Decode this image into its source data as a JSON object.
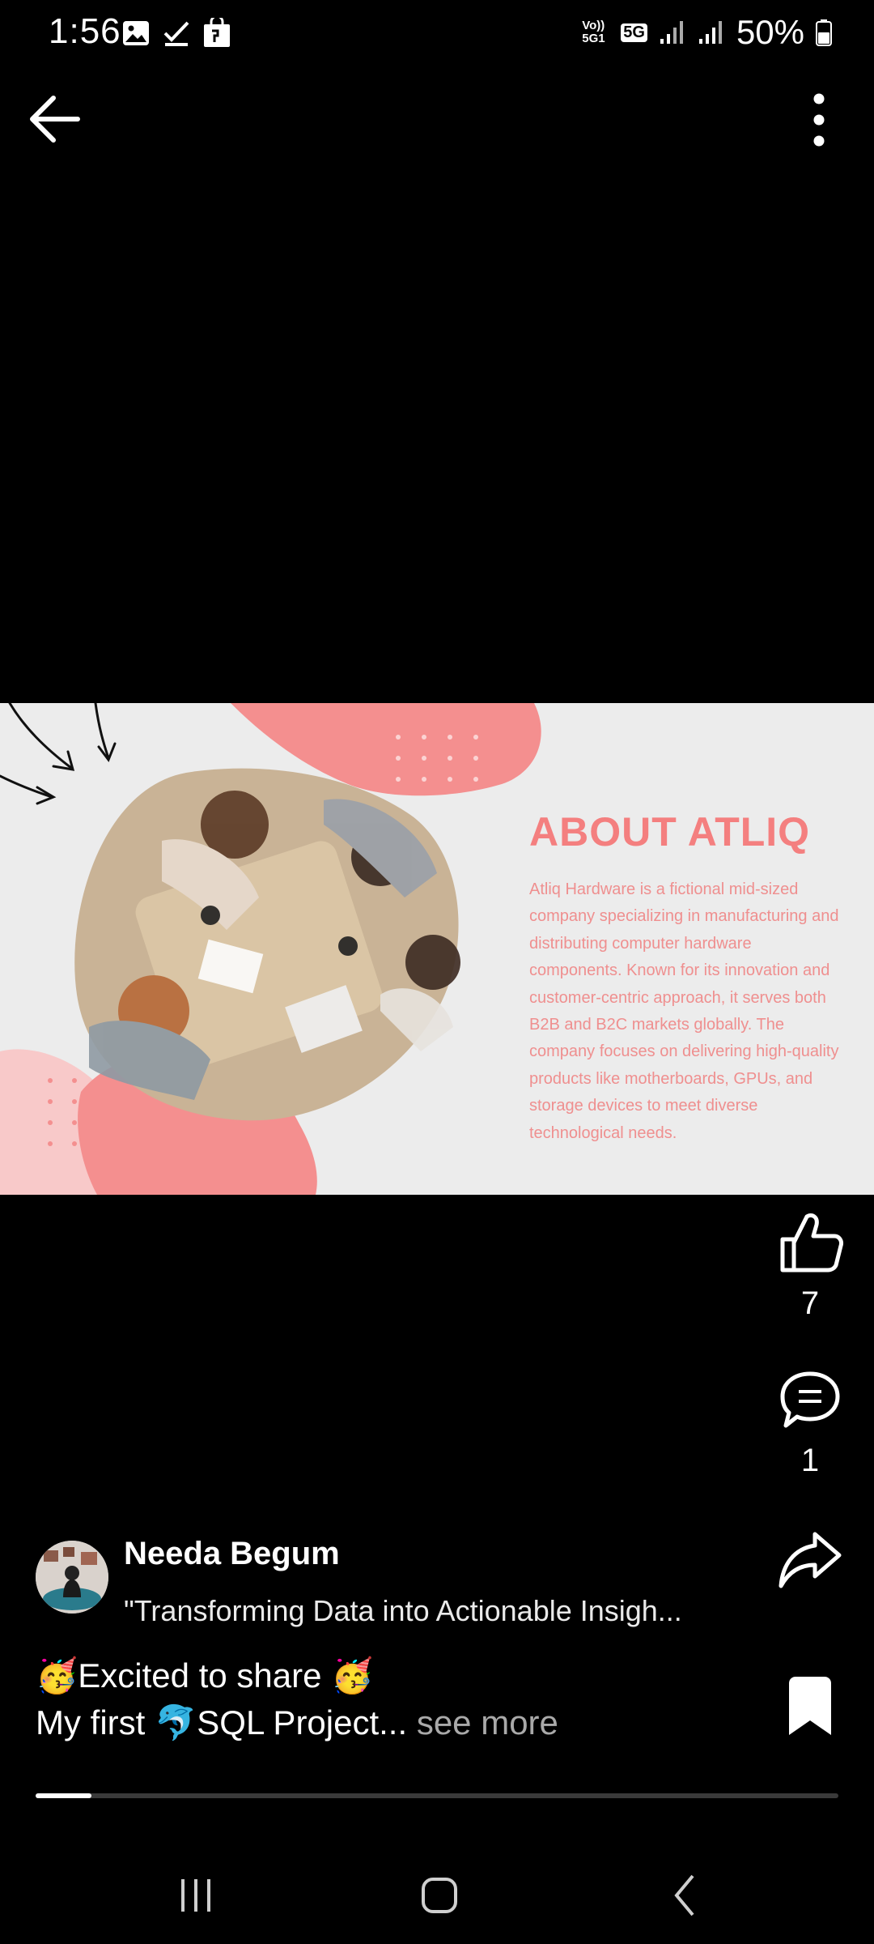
{
  "status_bar": {
    "time": "1:56",
    "network": "5G",
    "volte": "Vo)) 5G1",
    "battery_percent": "50%",
    "left_icons": [
      "image-icon",
      "checkmark-icon",
      "shopping-bag-icon"
    ]
  },
  "top_bar": {
    "back_icon": "arrow-left-icon",
    "more_icon": "more-vertical-icon"
  },
  "slide": {
    "title": "ABOUT ATLIQ",
    "body": "Atliq Hardware is a fictional mid-sized company specializing in manufacturing and distributing computer hardware components. Known for its innovation and customer-centric approach, it serves both B2B and B2C markets globally. The company focuses on delivering high-quality products like motherboards, GPUs, and storage devices to meet diverse technological needs.",
    "accent_color": "#f47f7f"
  },
  "actions": {
    "likes": "7",
    "comments": "1"
  },
  "post": {
    "author": "Needa Begum",
    "headline": "\"Transforming Data into Actionable Insigh...",
    "caption_line1": "🥳Excited to share 🥳",
    "caption_line2": "My first 🐬SQL Project...",
    "see_more": " see more",
    "progress": 0.07
  },
  "nav": {
    "recents_icon": "recents-icon",
    "home_icon": "home-icon",
    "back_icon": "back-chevron-icon"
  }
}
